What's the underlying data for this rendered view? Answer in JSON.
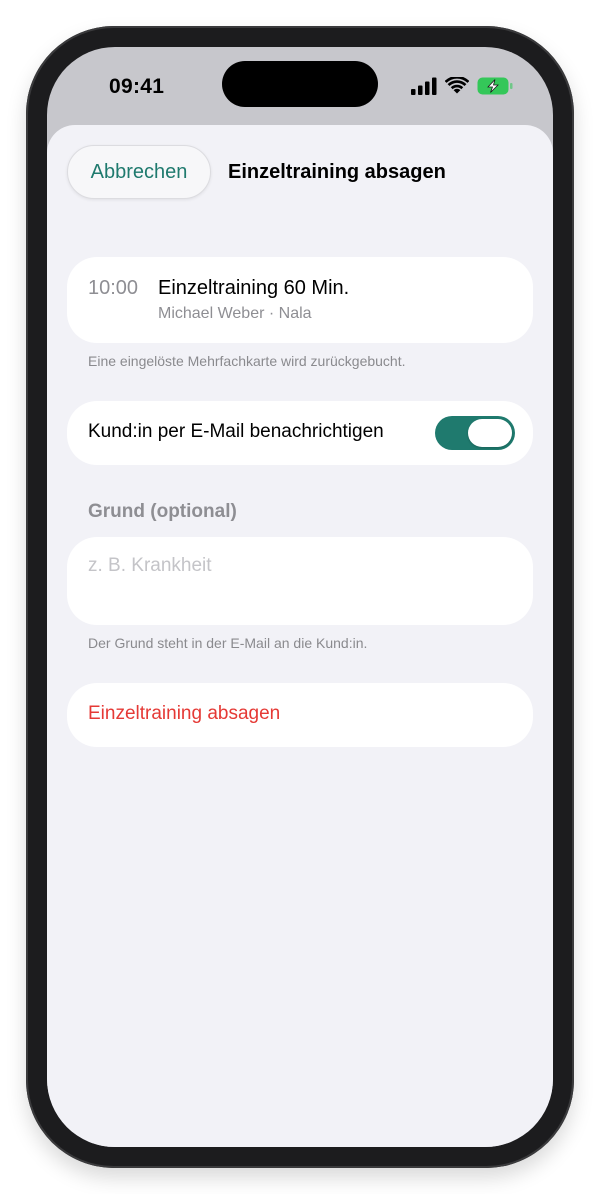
{
  "status_bar": {
    "time": "09:41",
    "icons": [
      "cellular-signal-icon",
      "wifi-icon",
      "battery-charging-icon"
    ],
    "battery_color": "#34c759"
  },
  "sheet": {
    "cancel_label": "Abbrechen",
    "title": "Einzeltraining absagen"
  },
  "appointment": {
    "time": "10:00",
    "title": "Einzeltraining 60 Min.",
    "subtitle": "Michael Weber · Nala",
    "footnote": "Eine eingelöste Mehrfachkarte wird zurückgebucht."
  },
  "notify": {
    "label": "Kund:in per E-Mail benachrichtigen",
    "enabled": true
  },
  "reason": {
    "header": "Grund (optional)",
    "value": "",
    "placeholder": "z. B. Krankheit",
    "footnote": "Der Grund steht in der E-Mail an die Kund:in."
  },
  "action": {
    "label": "Einzeltraining absagen"
  },
  "colors": {
    "accent": "#1f7a6e",
    "destructive": "#e53935",
    "background": "#f2f2f7"
  }
}
